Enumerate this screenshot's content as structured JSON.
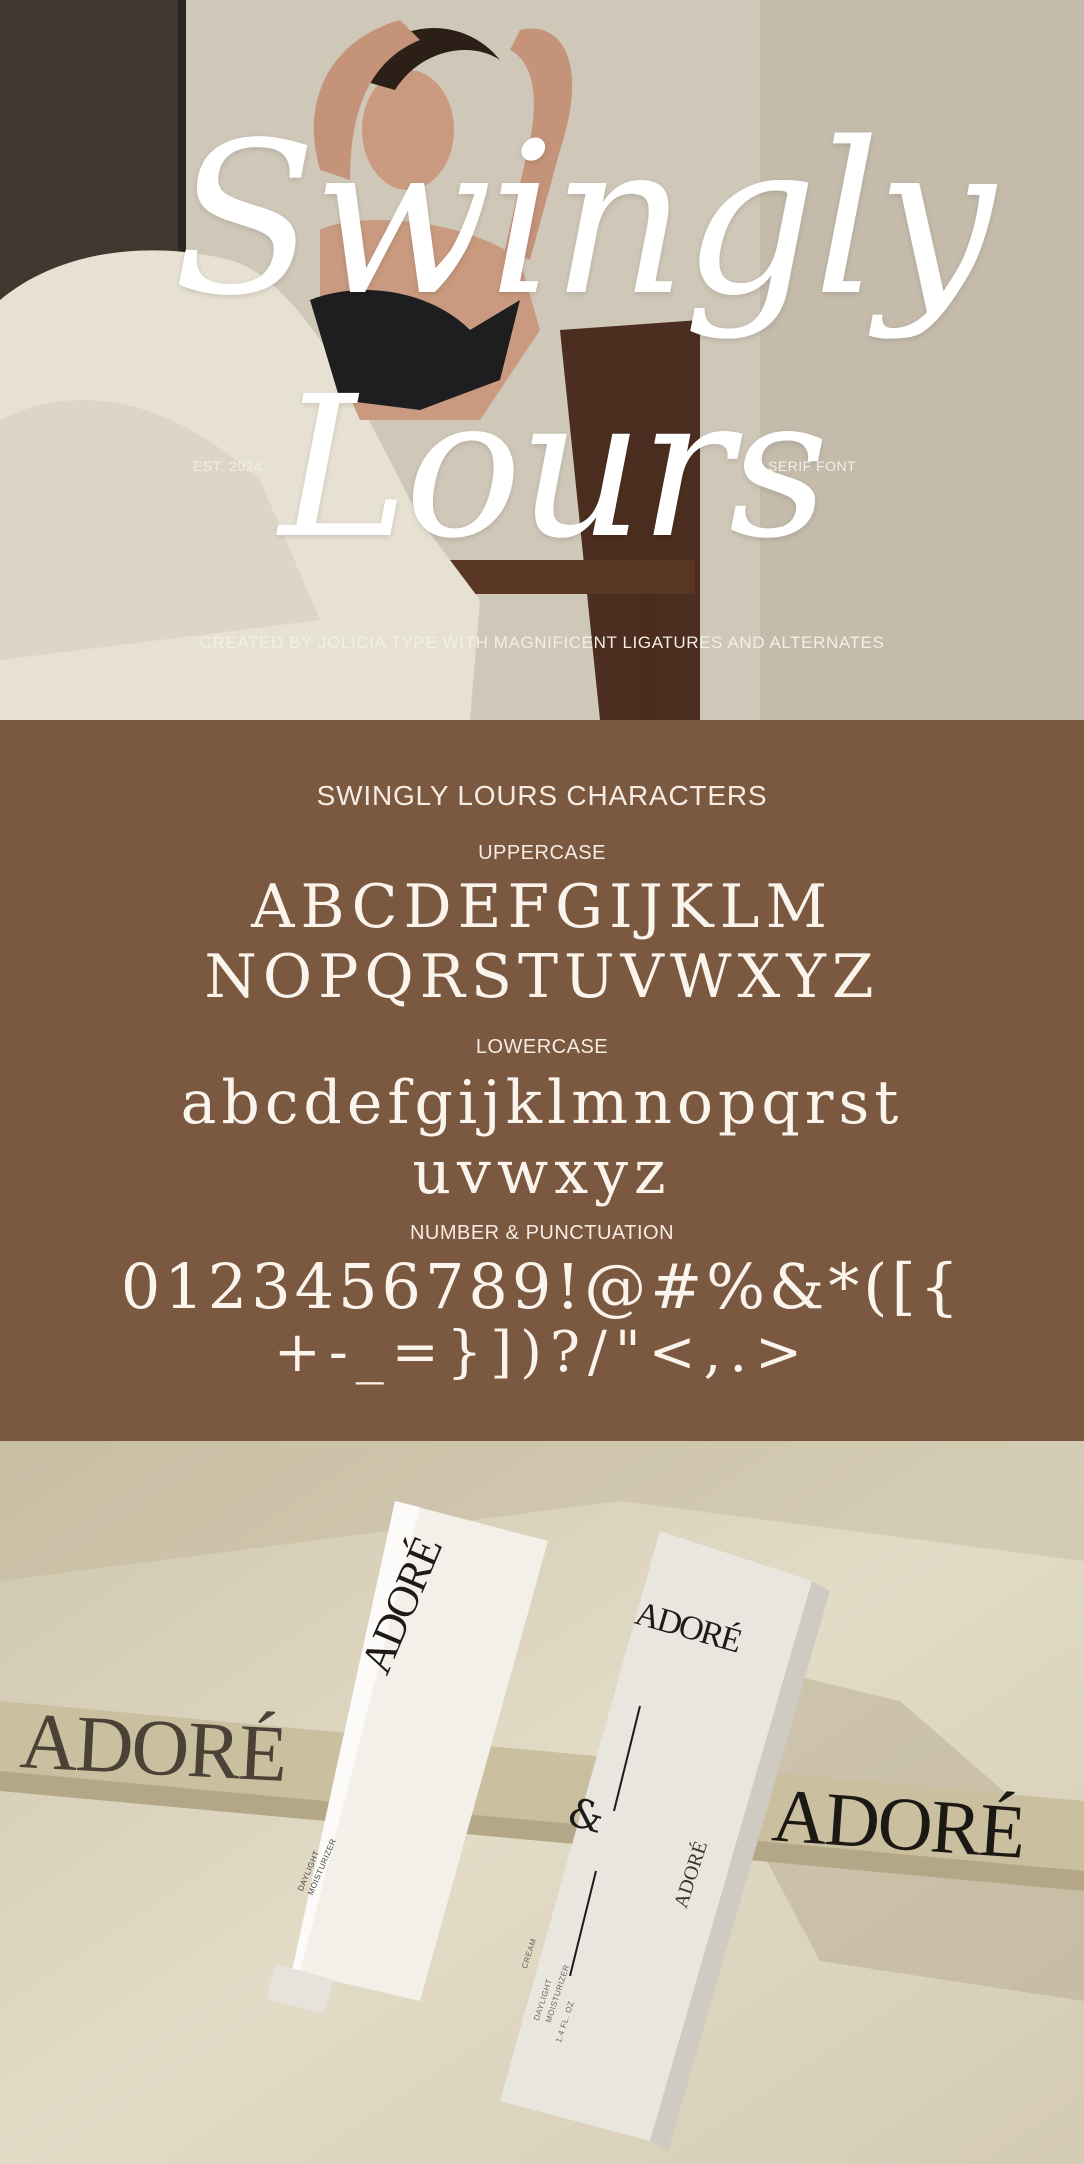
{
  "hero": {
    "title_line1": "Swingly",
    "title_line2": "Lours",
    "est": "EST. 2024",
    "category": "SERIF FONT",
    "credit": "CREATED BY JOLICIA TYPE WITH MAGNIFICENT LIGATURES AND ALTERNATES"
  },
  "characters": {
    "heading": "SWINGLY LOURS CHARACTERS",
    "uppercase_label": "UPPERCASE",
    "uppercase_line1": "ABCDEFGIJKLM",
    "uppercase_line2": "NOPQRSTUVWXYZ",
    "lowercase_label": "LOWERCASE",
    "lowercase_line1": "abcdefgijklmnopqrst",
    "lowercase_line2": "uvwxyz",
    "numbers_label": "NUMBER & PUNCTUATION",
    "numbers_line1": "0123456789!@#%&*([{",
    "numbers_line2": "+-_=}])?/\"<,.>"
  },
  "product": {
    "brand_left": "ADORÉ",
    "brand_right": "ADORÉ",
    "brand_tube": "ADORÉ",
    "brand_box": "ADORÉ",
    "brand_box_side": "ADORÉ",
    "box_ampersand": "&",
    "box_cream": "CREAM",
    "box_daylight": "DAYLIGHT",
    "box_moisturizer": "MOISTURIZER",
    "box_size": "1.4 FL. OZ",
    "tube_daylight": "DAYLIGHT",
    "tube_moisturizer": "MOISTURIZER"
  },
  "colors": {
    "brown_band": "#7b5840",
    "cream_text": "#f6ece3",
    "stone": "#d9d0b8"
  }
}
